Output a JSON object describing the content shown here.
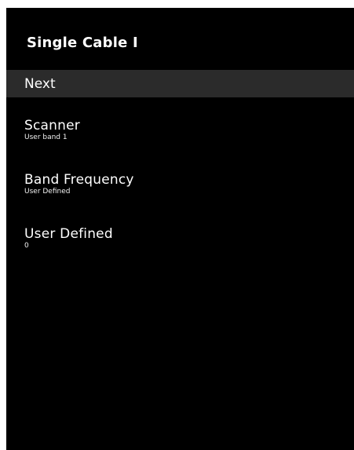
{
  "screen": {
    "title": "Single Cable I",
    "next_label": "Next",
    "items": [
      {
        "label": "Scanner",
        "value": "User band 1"
      },
      {
        "label": "Band Frequency",
        "value": "User Defined"
      },
      {
        "label": "User Defined",
        "value": "0"
      }
    ]
  }
}
